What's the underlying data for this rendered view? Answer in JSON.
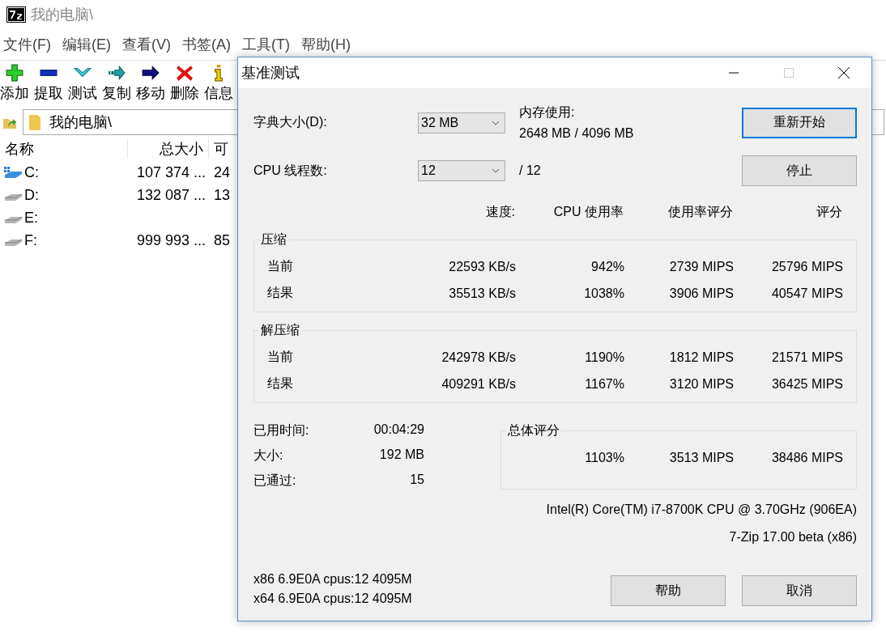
{
  "main_window": {
    "title": "我的电脑\\",
    "menu": [
      "文件(F)",
      "编辑(E)",
      "查看(V)",
      "书签(A)",
      "工具(T)",
      "帮助(H)"
    ],
    "toolbar": [
      {
        "label": "添加",
        "kind": "add"
      },
      {
        "label": "提取",
        "kind": "extract"
      },
      {
        "label": "测试",
        "kind": "test"
      },
      {
        "label": "复制",
        "kind": "copy"
      },
      {
        "label": "移动",
        "kind": "move"
      },
      {
        "label": "删除",
        "kind": "delete"
      },
      {
        "label": "信息",
        "kind": "info"
      }
    ],
    "address": "我的电脑\\",
    "columns": [
      "名称",
      "总大小",
      "可"
    ],
    "rows": [
      {
        "name": "C:",
        "kind": "system",
        "total": "107 374 ...",
        "column_3": "24"
      },
      {
        "name": "D:",
        "kind": "drive",
        "total": "132 087 ...",
        "column_3": "13"
      },
      {
        "name": "E:",
        "kind": "drive"
      },
      {
        "name": "F:",
        "kind": "drive",
        "total": "999 993 ...",
        "column_3": "85"
      }
    ]
  },
  "dialog": {
    "title": "基准测试",
    "dictionary": {
      "label": "字典大小(D):",
      "value": "32 MB"
    },
    "threads": {
      "label": "CPU 线程数:",
      "value": "12",
      "max": "/ 12"
    },
    "memory": {
      "label": "内存使用:",
      "value": "2648 MB / 4096 MB"
    },
    "buttons": [
      {
        "label": "重新开始",
        "focused": true
      },
      {
        "label": "停止",
        "focused": false
      }
    ],
    "columns": [
      "速度:",
      "CPU 使用率",
      "使用率评分",
      "评分"
    ],
    "groups": [
      {
        "title": "压缩",
        "rows": [
          {
            "label": "当前",
            "values": [
              "22593 KB/s",
              "942%",
              "2739 MIPS",
              "25796 MIPS"
            ]
          },
          {
            "label": "结果",
            "values": [
              "35513 KB/s",
              "1038%",
              "3906 MIPS",
              "40547 MIPS"
            ]
          }
        ]
      },
      {
        "title": "解压缩",
        "rows": [
          {
            "label": "当前",
            "values": [
              "242978 KB/s",
              "1190%",
              "1812 MIPS",
              "21571 MIPS"
            ]
          },
          {
            "label": "结果",
            "values": [
              "409291 KB/s",
              "1167%",
              "3120 MIPS",
              "36425 MIPS"
            ]
          }
        ]
      }
    ],
    "stats": [
      {
        "label": "已用时间:",
        "value": "00:04:29"
      },
      {
        "label": "大小:",
        "value": "192 MB"
      },
      {
        "label": "已通过:",
        "value": "15"
      }
    ],
    "total": {
      "title": "总体评分",
      "values": [
        "1103%",
        "3513 MIPS",
        "38486 MIPS"
      ]
    },
    "cpu": "Intel(R) Core(TM) i7-8700K CPU @ 3.70GHz (906EA)",
    "version": "7-Zip 17.00 beta (x86)",
    "info_lines": [
      "x86 6.9E0A cpus:12 4095M",
      "x64 6.9E0A cpus:12 4095M"
    ],
    "bottom_buttons": [
      "帮助",
      "取消"
    ]
  }
}
